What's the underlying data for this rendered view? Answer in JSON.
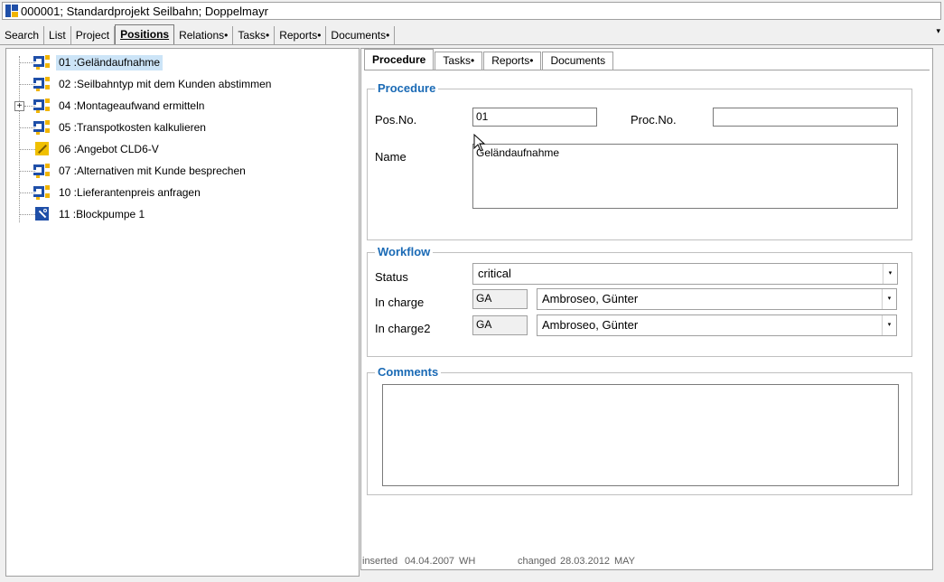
{
  "window": {
    "title": "000001; Standardprojekt Seilbahn; Doppelmayr"
  },
  "main_tabs": [
    {
      "label": "Search"
    },
    {
      "label": "List"
    },
    {
      "label": "Project"
    },
    {
      "label": "Positions",
      "active": true
    },
    {
      "label": "Relations•"
    },
    {
      "label": "Tasks•"
    },
    {
      "label": "Reports•"
    },
    {
      "label": "Documents•"
    }
  ],
  "tree": {
    "items": [
      {
        "label": "01 :Geländaufnahme",
        "icon": "procedure-icon",
        "selected": true
      },
      {
        "label": "02 :Seilbahntyp mit dem Kunden abstimmen",
        "icon": "procedure-icon"
      },
      {
        "label": "04 :Montageaufwand ermitteln",
        "icon": "procedure-icon",
        "expandable": true
      },
      {
        "label": "05 :Transpotkosten kalkulieren",
        "icon": "procedure-icon"
      },
      {
        "label": "06 :Angebot CLD6-V",
        "icon": "edit-icon"
      },
      {
        "label": "07 :Alternativen mit Kunde besprechen",
        "icon": "procedure-icon"
      },
      {
        "label": "10 :Lieferantenpreis anfragen",
        "icon": "procedure-icon"
      },
      {
        "label": "11 :Blockpumpe 1",
        "icon": "tool-icon"
      }
    ]
  },
  "sub_tabs": [
    {
      "label": "Procedure",
      "active": true
    },
    {
      "label": "Tasks•"
    },
    {
      "label": "Reports•"
    },
    {
      "label": "Documents"
    }
  ],
  "procedure": {
    "group_title": "Procedure",
    "pos_no_label": "Pos.No.",
    "pos_no_value": "01",
    "proc_no_label": "Proc.No.",
    "proc_no_value": "",
    "name_label": "Name",
    "name_value": "Geländaufnahme"
  },
  "workflow": {
    "group_title": "Workflow",
    "status_label": "Status",
    "status_value": "critical",
    "in_charge_label": "In charge",
    "in_charge_code": "GA",
    "in_charge_name": "Ambroseo, Günter",
    "in_charge2_label": "In charge2",
    "in_charge2_code": "GA",
    "in_charge2_name": "Ambroseo, Günter"
  },
  "comments": {
    "group_title": "Comments",
    "value": ""
  },
  "footer": {
    "inserted_label": "inserted",
    "inserted_date": "04.04.2007",
    "inserted_by": "WH",
    "changed_label": "changed",
    "changed_date": "28.03.2012",
    "changed_by": "MAY"
  },
  "icons": {
    "dropdown_arrow": "▾",
    "expand": "+"
  },
  "colors": {
    "group_title": "#1a6ab5",
    "selection": "#cce4f7",
    "icon_blue": "#1f4fa8",
    "icon_yellow": "#f0b400"
  }
}
